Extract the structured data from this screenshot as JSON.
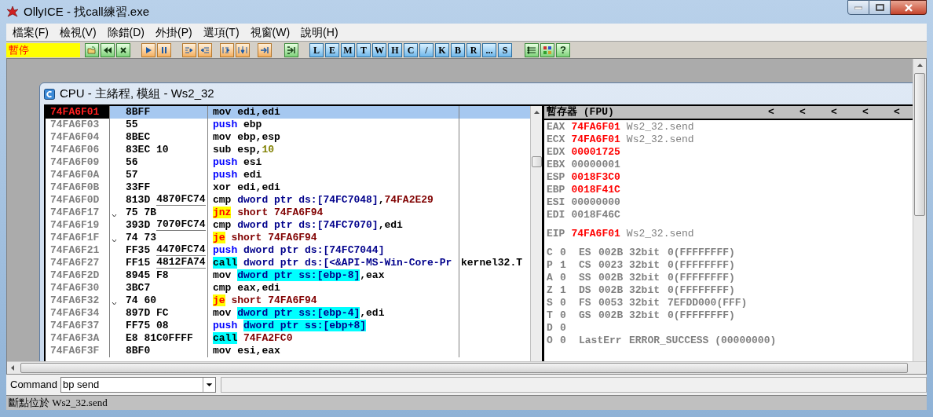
{
  "window": {
    "title": "OllyICE - 找call練習.exe"
  },
  "menu": [
    {
      "label": "檔案(F)"
    },
    {
      "label": "檢視(V)"
    },
    {
      "label": "除錯(D)"
    },
    {
      "label": "外掛(P)"
    },
    {
      "label": "選項(T)"
    },
    {
      "label": "視窗(W)"
    },
    {
      "label": "說明(H)"
    }
  ],
  "toolbar": {
    "status": "暫停",
    "letter_buttons": [
      "L",
      "E",
      "M",
      "T",
      "W",
      "H",
      "C",
      "/",
      "K",
      "B",
      "R",
      "...",
      "S"
    ],
    "help": "?"
  },
  "cpu_window": {
    "title": "CPU - 主緒程, 模組 - Ws2_32",
    "disassembly": [
      {
        "address": "74FA6F01",
        "selected": true,
        "jump": false,
        "hex": "8BFF",
        "code": [
          {
            "text": "mov edi,edi",
            "kind": "plain"
          }
        ]
      },
      {
        "address": "74FA6F03",
        "selected": false,
        "jump": false,
        "hex": "55",
        "code": [
          {
            "text": "push",
            "kind": "kw"
          },
          {
            "text": " ebp",
            "kind": "plain"
          }
        ]
      },
      {
        "address": "74FA6F04",
        "selected": false,
        "jump": false,
        "hex": "8BEC",
        "code": [
          {
            "text": "mov ebp,esp",
            "kind": "plain"
          }
        ]
      },
      {
        "address": "74FA6F06",
        "selected": false,
        "jump": false,
        "hex": "83EC 10",
        "code": [
          {
            "text": "sub esp,",
            "kind": "plain"
          },
          {
            "text": "10",
            "kind": "num"
          }
        ]
      },
      {
        "address": "74FA6F09",
        "selected": false,
        "jump": false,
        "hex": "56",
        "code": [
          {
            "text": "push",
            "kind": "kw"
          },
          {
            "text": " esi",
            "kind": "plain"
          }
        ]
      },
      {
        "address": "74FA6F0A",
        "selected": false,
        "jump": false,
        "hex": "57",
        "code": [
          {
            "text": "push",
            "kind": "kw"
          },
          {
            "text": " edi",
            "kind": "plain"
          }
        ]
      },
      {
        "address": "74FA6F0B",
        "selected": false,
        "jump": false,
        "hex": "33FF",
        "code": [
          {
            "text": "xor edi,edi",
            "kind": "plain"
          }
        ]
      },
      {
        "address": "74FA6F0D",
        "selected": false,
        "jump": false,
        "hex": "813D",
        "hex_operand": "4870FC74",
        "code": [
          {
            "text": "cmp ",
            "kind": "plain"
          },
          {
            "text": "dword ptr ds:[74FC7048]",
            "kind": "ptr"
          },
          {
            "text": ",",
            "kind": "plain"
          },
          {
            "text": "74FA2E29",
            "kind": "addr"
          }
        ]
      },
      {
        "address": "74FA6F17",
        "selected": false,
        "jump": true,
        "hex": "75 7B",
        "code": [
          {
            "text": "jnz",
            "kind": "jcc"
          },
          {
            "text": " short 74FA6F94",
            "kind": "addr"
          }
        ]
      },
      {
        "address": "74FA6F19",
        "selected": false,
        "jump": false,
        "hex": "393D",
        "hex_operand": "7070FC74",
        "code": [
          {
            "text": "cmp ",
            "kind": "plain"
          },
          {
            "text": "dword ptr ds:[74FC7070]",
            "kind": "ptr"
          },
          {
            "text": ",edi",
            "kind": "plain"
          }
        ]
      },
      {
        "address": "74FA6F1F",
        "selected": false,
        "jump": true,
        "hex": "74 73",
        "code": [
          {
            "text": "je",
            "kind": "jcc"
          },
          {
            "text": " short 74FA6F94",
            "kind": "addr"
          }
        ]
      },
      {
        "address": "74FA6F21",
        "selected": false,
        "jump": false,
        "hex": "FF35",
        "hex_operand": "4470FC74",
        "code": [
          {
            "text": "push",
            "kind": "kw"
          },
          {
            "text": " dword ptr ds:[74FC7044]",
            "kind": "ptr"
          }
        ]
      },
      {
        "address": "74FA6F27",
        "selected": false,
        "jump": false,
        "hex": "FF15",
        "hex_operand": "4812FA74",
        "code": [
          {
            "text": "call",
            "kind": "call"
          },
          {
            "text": " dword ptr ds:[<&API-MS-Win-Core-Pr",
            "kind": "ptr"
          }
        ],
        "comment": "kernel32.T"
      },
      {
        "address": "74FA6F2D",
        "selected": false,
        "jump": false,
        "hex": "8945 F8",
        "code": [
          {
            "text": "mov ",
            "kind": "plain"
          },
          {
            "text": "dword ptr ss:[ebp-8]",
            "kind": "mem"
          },
          {
            "text": ",eax",
            "kind": "plain"
          }
        ]
      },
      {
        "address": "74FA6F30",
        "selected": false,
        "jump": false,
        "hex": "3BC7",
        "code": [
          {
            "text": "cmp eax,edi",
            "kind": "plain"
          }
        ]
      },
      {
        "address": "74FA6F32",
        "selected": false,
        "jump": true,
        "hex": "74 60",
        "code": [
          {
            "text": "je",
            "kind": "jcc"
          },
          {
            "text": " short 74FA6F94",
            "kind": "addr"
          }
        ]
      },
      {
        "address": "74FA6F34",
        "selected": false,
        "jump": false,
        "hex": "897D FC",
        "code": [
          {
            "text": "mov ",
            "kind": "plain"
          },
          {
            "text": "dword ptr ss:[ebp-4]",
            "kind": "mem"
          },
          {
            "text": ",edi",
            "kind": "plain"
          }
        ]
      },
      {
        "address": "74FA6F37",
        "selected": false,
        "jump": false,
        "hex": "FF75 08",
        "code": [
          {
            "text": "push ",
            "kind": "kw"
          },
          {
            "text": "dword ptr ss:[ebp+8]",
            "kind": "mem"
          }
        ]
      },
      {
        "address": "74FA6F3A",
        "selected": false,
        "jump": false,
        "hex": "E8 81C0FFFF",
        "code": [
          {
            "text": "call",
            "kind": "call"
          },
          {
            "text": " 74FA2FC0",
            "kind": "addr"
          }
        ]
      },
      {
        "address": "74FA6F3F",
        "selected": false,
        "jump": false,
        "hex": "8BF0",
        "code": [
          {
            "text": "mov esi,eax",
            "kind": "plain"
          }
        ]
      }
    ],
    "registers": {
      "title": "暫存器 (FPU)",
      "nav_arrows": [
        "<",
        "<",
        "<",
        "<",
        "<"
      ],
      "general": [
        {
          "name": "EAX",
          "value": "74FA6F01",
          "changed": true,
          "comment": "Ws2_32.send"
        },
        {
          "name": "ECX",
          "value": "74FA6F01",
          "changed": true,
          "comment": "Ws2_32.send"
        },
        {
          "name": "EDX",
          "value": "00001725",
          "changed": true
        },
        {
          "name": "EBX",
          "value": "00000001",
          "changed": false
        },
        {
          "name": "ESP",
          "value": "0018F3C0",
          "changed": true
        },
        {
          "name": "EBP",
          "value": "0018F41C",
          "changed": true
        },
        {
          "name": "ESI",
          "value": "00000000",
          "changed": false
        },
        {
          "name": "EDI",
          "value": "0018F46C",
          "changed": false
        }
      ],
      "eip": {
        "name": "EIP",
        "value": "74FA6F01",
        "changed": true,
        "comment": "Ws2_32.send"
      },
      "flags": [
        {
          "kind": "segment",
          "flag": "C",
          "bit": "0",
          "segment": "ES",
          "selector": "002B",
          "width": "32bit",
          "base": "0(FFFFFFFF)"
        },
        {
          "kind": "segment",
          "flag": "P",
          "bit": "1",
          "segment": "CS",
          "selector": "0023",
          "width": "32bit",
          "base": "0(FFFFFFFF)"
        },
        {
          "kind": "segment",
          "flag": "A",
          "bit": "0",
          "segment": "SS",
          "selector": "002B",
          "width": "32bit",
          "base": "0(FFFFFFFF)"
        },
        {
          "kind": "segment",
          "flag": "Z",
          "bit": "1",
          "segment": "DS",
          "selector": "002B",
          "width": "32bit",
          "base": "0(FFFFFFFF)"
        },
        {
          "kind": "segment",
          "flag": "S",
          "bit": "0",
          "segment": "FS",
          "selector": "0053",
          "width": "32bit",
          "base": "7EFDD000(FFF)"
        },
        {
          "kind": "segment",
          "flag": "T",
          "bit": "0",
          "segment": "GS",
          "selector": "002B",
          "width": "32bit",
          "base": "0(FFFFFFFF)"
        },
        {
          "kind": "plain",
          "flag": "D",
          "bit": "0"
        },
        {
          "kind": "lasterr",
          "flag": "O",
          "bit": "0",
          "label": "LastErr",
          "error": "ERROR_SUCCESS (00000000)"
        }
      ]
    }
  },
  "command": {
    "label": "Command",
    "value": "bp send"
  },
  "status_bar": "斷點位於 Ws2_32.send"
}
